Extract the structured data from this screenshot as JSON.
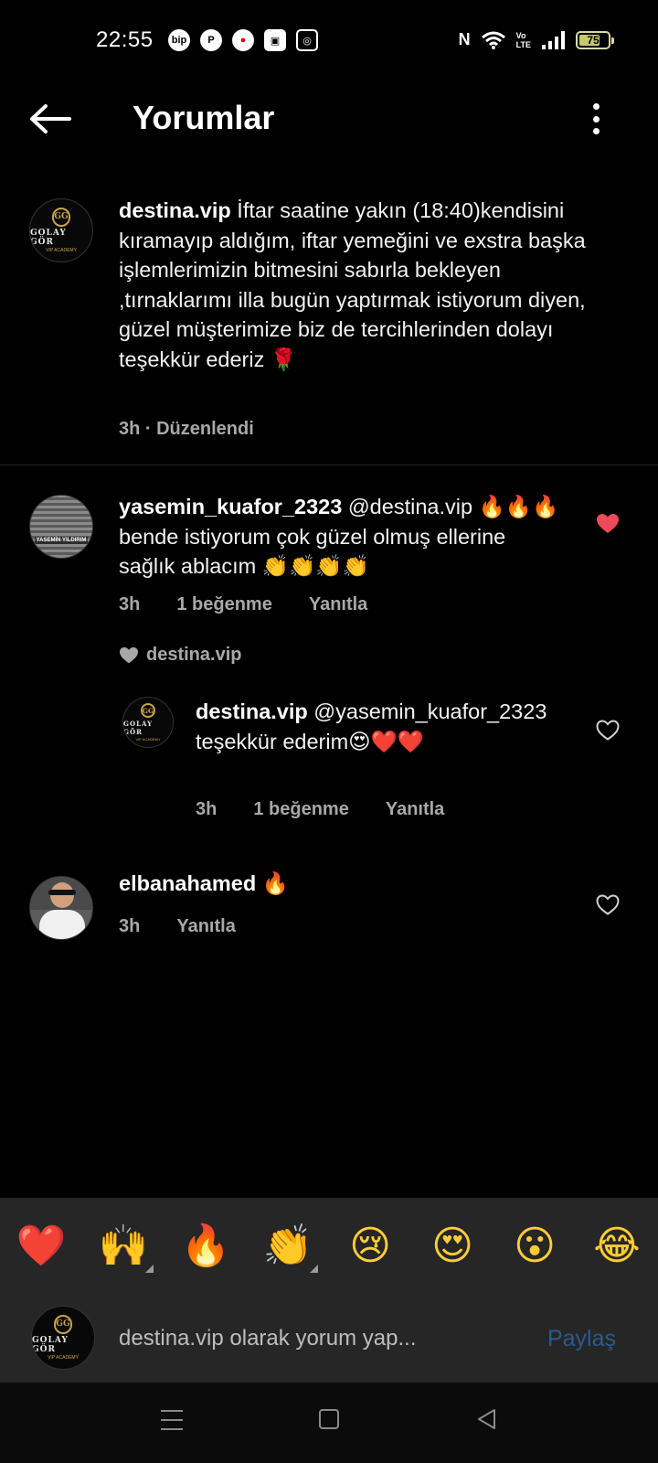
{
  "status_bar": {
    "time": "22:55",
    "left_icons": [
      "bip-icon",
      "pinterest-icon",
      "vodafone-icon",
      "box-icon",
      "instagram-icon"
    ],
    "right_icons": [
      "nfc-icon",
      "wifi-icon",
      "volte-icon",
      "signal-icon"
    ],
    "volte_top": "Vo",
    "volte_bottom": "LTE",
    "battery": "75",
    "battery_level": 0.75
  },
  "header": {
    "title": "Yorumlar"
  },
  "caption": {
    "username": "destina.vip",
    "text": "İftar saatine yakın (18:40)kendisini kıramayıp aldığım, iftar yemeğini ve exstra başka işlemlerimizin bitmesini sabırla bekleyen ,tırnaklarımı illa bugün yaptırmak istiyorum diyen,  güzel müşterimize biz de tercihlerinden dolayı teşekkür ederiz 🌹",
    "meta": "3h · Düzenlendi"
  },
  "comments": [
    {
      "username": "yasemin_kuafor_2323",
      "avatar_text": "YASEMİN YILDIRIM",
      "text": "@destina.vip 🔥🔥🔥 bende istiyorum çok güzel olmuş ellerine sağlık ablacım 👏👏👏👏",
      "time": "3h",
      "likes": "1 beğenme",
      "reply": "Yanıtla",
      "liked": true,
      "liked_by": "destina.vip"
    },
    {
      "username": "destina.vip",
      "text": "@yasemin_kuafor_2323 teşekkür ederim😍❤️❤️",
      "time": "3h",
      "likes": "1 beğenme",
      "reply": "Yanıtla",
      "liked": false
    },
    {
      "username": "elbanahamed",
      "text": "🔥",
      "time": "3h",
      "reply": "Yanıtla",
      "liked": false
    }
  ],
  "logo": {
    "mark": "GG",
    "name": "GOLAY GÖR",
    "sub": "VIP ACADEMY"
  },
  "emoji_bar": [
    "❤️",
    "🙌",
    "🔥",
    "👏",
    "😢",
    "😍",
    "😮",
    "😂"
  ],
  "input": {
    "placeholder": "destina.vip olarak yorum yap...",
    "share": "Paylaş"
  },
  "colors": {
    "background": "#000000",
    "heart_liked": "#ed4956",
    "share_disabled": "#2a5a90",
    "secondary_text": "#a8a8a8"
  }
}
